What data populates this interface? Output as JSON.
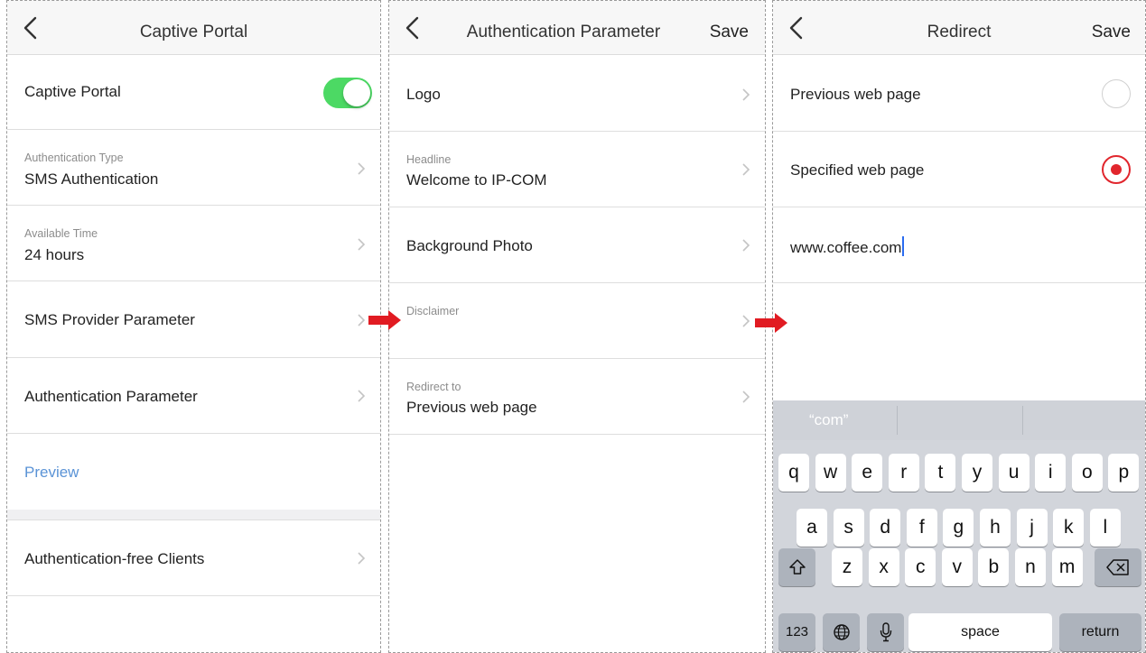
{
  "colors": {
    "accent_green": "#4cd964",
    "radio_red": "#e1262d",
    "arrow_red": "#e11b22",
    "link_blue": "#5a93d6"
  },
  "screen1": {
    "title": "Captive Portal",
    "captive_portal_label": "Captive Portal",
    "captive_portal_enabled": true,
    "auth_type": {
      "label": "Authentication Type",
      "value": "SMS Authentication"
    },
    "available_time": {
      "label": "Available Time",
      "value": "24 hours"
    },
    "sms_provider_label": "SMS Provider Parameter",
    "auth_param_label": "Authentication Parameter",
    "preview_label": "Preview",
    "auth_free_label": "Authentication-free Clients"
  },
  "screen2": {
    "title": "Authentication Parameter",
    "save_label": "Save",
    "logo_label": "Logo",
    "headline": {
      "label": "Headline",
      "value": "Welcome to IP-COM"
    },
    "background_label": "Background Photo",
    "disclaimer_label": "Disclaimer",
    "redirect": {
      "label": "Redirect to",
      "value": "Previous web page"
    }
  },
  "screen3": {
    "title": "Redirect",
    "save_label": "Save",
    "option_previous": "Previous web page",
    "option_specified": "Specified web page",
    "selected_option": "Specified web page",
    "url_value": "www.coffee.com"
  },
  "keyboard": {
    "prediction": "“com”",
    "row1": [
      "q",
      "w",
      "e",
      "r",
      "t",
      "y",
      "u",
      "i",
      "o",
      "p"
    ],
    "row2": [
      "a",
      "s",
      "d",
      "f",
      "g",
      "h",
      "j",
      "k",
      "l"
    ],
    "row3": [
      "z",
      "x",
      "c",
      "v",
      "b",
      "n",
      "m"
    ],
    "numbers_label": "123",
    "space_label": "space",
    "return_label": "return"
  }
}
